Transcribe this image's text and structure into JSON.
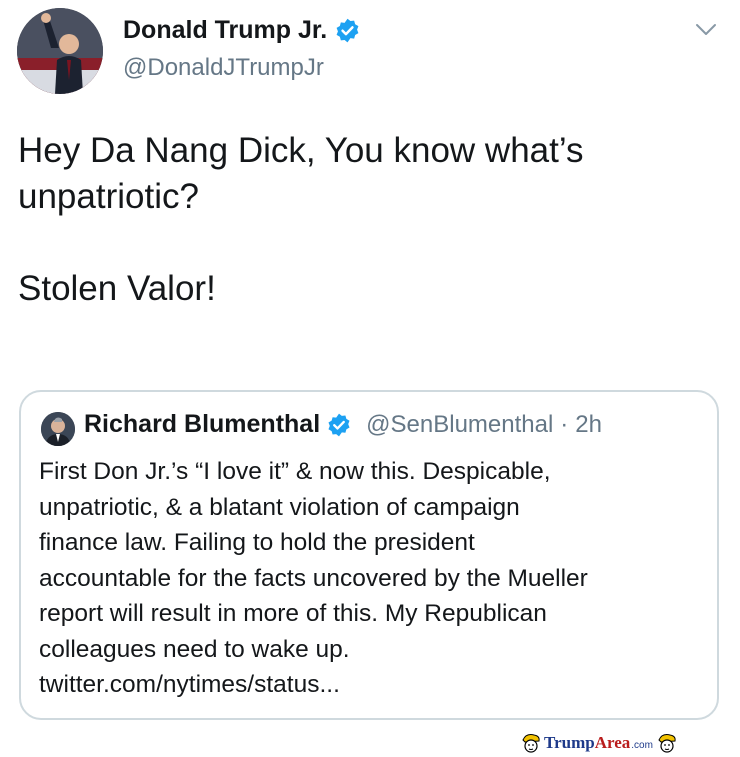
{
  "tweet": {
    "author_name": "Donald Trump Jr.",
    "author_handle": "@DonaldJTrumpJr",
    "text_lines": [
      "Hey Da Nang Dick, You know what’s",
      "unpatriotic?",
      "Stolen Valor!"
    ],
    "icons": {
      "verified": "verified-badge-icon",
      "menu": "chevron-down-icon"
    }
  },
  "quoted_tweet": {
    "author_name": "Richard Blumenthal",
    "author_handle": "@SenBlumenthal",
    "separator": "·",
    "time": "2h",
    "text_lines": [
      "First Don Jr.’s “I love it” & now this. Despicable,",
      "unpatriotic, & a blatant violation of campaign",
      "finance law. Failing to hold the president",
      "accountable for the facts uncovered by the Mueller",
      "report will result in more of this. My Republican",
      "colleagues need to wake up.",
      "twitter.com/nytimes/status..."
    ]
  },
  "watermark": {
    "part1": "Trump",
    "part2": "Area",
    "suffix": ".com"
  },
  "colors": {
    "verified_blue": "#1da1f2",
    "secondary_text": "#657786",
    "border": "#cfd9de"
  }
}
